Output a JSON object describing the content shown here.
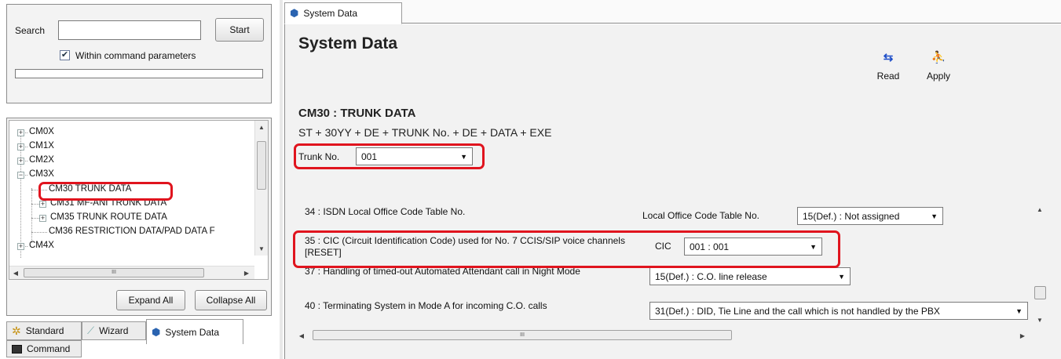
{
  "left": {
    "search_label": "Search",
    "search_value": "",
    "start_label": "Start",
    "within_label": "Within command parameters",
    "within_checked": "✔",
    "tree": [
      {
        "label": "CM0X",
        "exp": "+"
      },
      {
        "label": "CM1X",
        "exp": "+"
      },
      {
        "label": "CM2X",
        "exp": "+"
      },
      {
        "label": "CM3X",
        "exp": "−"
      },
      {
        "label": "CM30 TRUNK DATA",
        "exp": ""
      },
      {
        "label": "CM31 MF-ANI TRUNK DATA",
        "exp": "+"
      },
      {
        "label": "CM35 TRUNK ROUTE DATA",
        "exp": "+"
      },
      {
        "label": "CM36 RESTRICTION DATA/PAD DATA F",
        "exp": ""
      },
      {
        "label": "CM4X",
        "exp": "+"
      }
    ],
    "hscroll_grip": "III",
    "expand_all": "Expand All",
    "collapse_all": "Collapse All",
    "tabs": [
      {
        "label": "Standard",
        "icon": "gear-icon"
      },
      {
        "label": "Wizard",
        "icon": "wand-icon"
      },
      {
        "label": "System Data",
        "icon": "cube-icon"
      },
      {
        "label": "Command",
        "icon": "terminal-icon"
      }
    ]
  },
  "right": {
    "tab_label": "System Data",
    "title": "System Data",
    "read_label": "Read",
    "apply_label": "Apply",
    "cm_title": "CM30 : TRUNK DATA",
    "formula": "ST + 30YY + DE + TRUNK No. + DE + DATA + EXE",
    "trunk_label": "Trunk No.",
    "trunk_value": "001",
    "rows": [
      {
        "desc": "34 : ISDN Local Office Code Table No.",
        "field": "Local Office Code Table No.",
        "value": "15(Def.) : Not assigned"
      },
      {
        "desc": "35 : CIC (Circuit Identification Code) used for No. 7 CCIS/SIP voice channels [RESET]",
        "field": "CIC",
        "value": "001 :  001"
      },
      {
        "desc": "37 : Handling of timed-out Automated Attendant call in Night Mode",
        "field": "",
        "value": "15(Def.) : C.O. line release"
      },
      {
        "desc": "40 : Terminating System in Mode A for incoming C.O. calls",
        "field": "",
        "value": "31(Def.) : DID, Tie Line and the call which is not handled by the PBX"
      }
    ],
    "hscroll_grip": "III"
  },
  "colors": {
    "highlight": "#e0141e",
    "panel_bg": "#f2f2f2"
  }
}
